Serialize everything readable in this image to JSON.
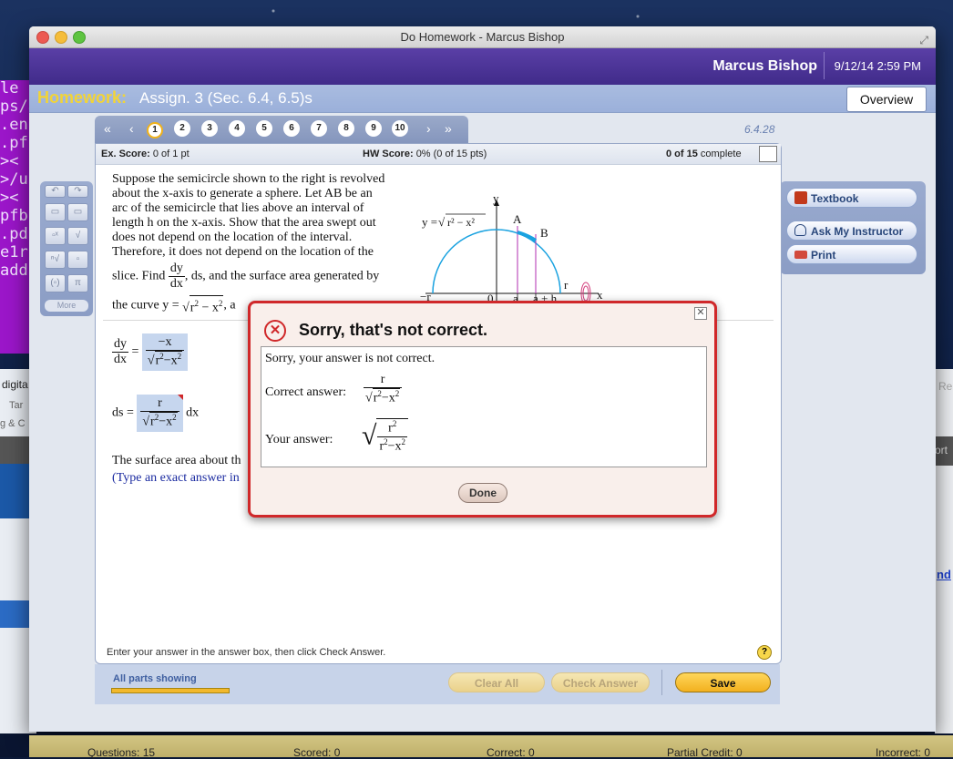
{
  "window_title": "Do Homework - Marcus Bishop",
  "header": {
    "user_name": "Marcus Bishop",
    "datetime": "9/12/14 2:59 PM"
  },
  "homework": {
    "label": "Homework:",
    "title": "Assign. 3 (Sec. 6.4, 6.5)s",
    "overview": "Overview"
  },
  "nav": {
    "questions": [
      "1",
      "2",
      "3",
      "4",
      "5",
      "6",
      "7",
      "8",
      "9",
      "10"
    ],
    "current": "1",
    "question_id": "6.4.28"
  },
  "score": {
    "ex_label": "Ex. Score:",
    "ex_value": "0 of 1 pt",
    "hw_label": "HW Score:",
    "hw_value": "0% (0 of 15 pts)",
    "complete_bold": "0 of 15",
    "complete_text": "complete"
  },
  "question": {
    "lines": [
      "Suppose the semicircle shown to the right is revolved",
      "about the x-axis to generate a sphere. Let AB be an",
      "arc of the semicircle that lies above an interval of",
      "length h on the x-axis. Show that the area swept out",
      "does not depend on the location of the interval.",
      "Therefore, it does not depend on the location of the"
    ],
    "slice_find": "slice. Find",
    "dy": "dy",
    "dx": "dx",
    "slice_rest": ", ds, and the surface  area generated by",
    "curve_prefix": "the curve y =",
    "curve_radicand_r": "r",
    "curve_radicand_rest": " − x",
    "two": "2",
    "curve_suffix": ", a",
    "surface_line": "The surface area about th",
    "type_line": "(Type an exact answer in"
  },
  "answers": {
    "dydx_num": "−x",
    "ds_label": "ds =",
    "ds_num": "r",
    "ds_suffix": "dx"
  },
  "diagram": {
    "y_label": "y",
    "curve_label": "y =",
    "A": "A",
    "B": "B",
    "r_right": "r",
    "x": "x",
    "neg_r": "−r",
    "zero": "0",
    "a": "a",
    "a_plus_h": "a + h",
    "h": "h"
  },
  "instructions": "Enter your answer in the answer box, then click Check Answer.",
  "bottom": {
    "all_parts": "All parts showing",
    "progress": 1.0,
    "clear_all": "Clear All",
    "check_answer": "Check Answer",
    "save": "Save"
  },
  "tools": {
    "textbook": "Textbook",
    "ask": "Ask My Instructor",
    "print": "Print",
    "more": "More"
  },
  "status": {
    "questions": "Questions: 15",
    "scored": "Scored: 0",
    "correct": "Correct: 0",
    "partial": "Partial Credit: 0",
    "incorrect": "Incorrect: 0"
  },
  "modal": {
    "title": "Sorry, that's not correct.",
    "message": "Sorry, your answer is not correct.",
    "correct_label": "Correct answer:",
    "correct_num": "r",
    "your_label": "Your answer:",
    "done": "Done"
  },
  "background": {
    "term_lines": [
      "le",
      "ps/a",
      ".enc",
      ".pf",
      "><",
      ">/u",
      "><",
      "pfb",
      ".pdf",
      "e1r",
      "add"
    ],
    "digital": "digita",
    "tar": "Tar",
    "g_c": "g & C",
    "re": "Re",
    "ort": "ort",
    "nd": "nd"
  },
  "colors": {
    "accent_purple": "#402b8a",
    "error_red": "#d0282a",
    "save_gold": "#f2b01f",
    "hw_gold": "#f2d437"
  }
}
